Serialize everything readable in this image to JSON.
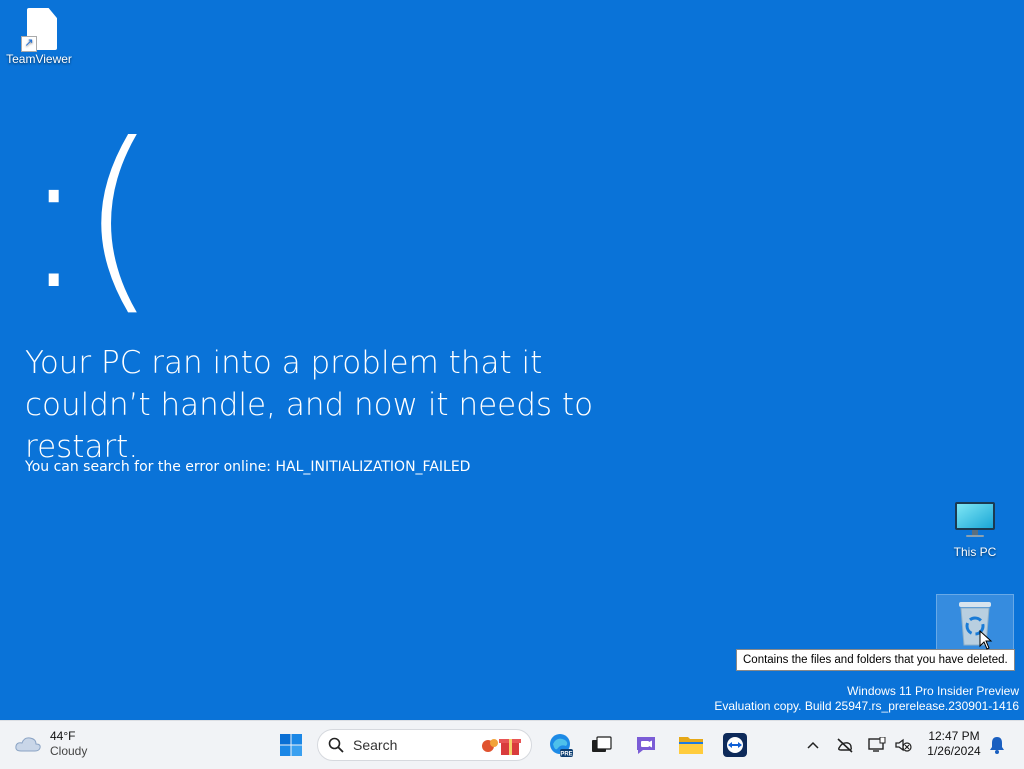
{
  "desktop": {
    "icons": [
      {
        "label": "TeamViewer"
      },
      {
        "label": "This PC"
      },
      {
        "label": "Recycle Bin"
      }
    ],
    "tooltip": "Contains the files and folders that you have deleted."
  },
  "bsod": {
    "face": ":(",
    "headline": "Your PC ran into a problem that it couldn’t handle, and now it needs to restart.",
    "search_hint": "You can search for the error online: HAL_INITIALIZATION_FAILED"
  },
  "watermark": {
    "line1": "Windows 11 Pro Insider Preview",
    "line2": "Evaluation copy. Build 25947.rs_prerelease.230901-1416"
  },
  "taskbar": {
    "weather": {
      "temp": "44°F",
      "condition": "Cloudy"
    },
    "search_placeholder": "Search",
    "clock": {
      "time": "12:47 PM",
      "date": "1/26/2024"
    }
  },
  "colors": {
    "bsod_blue": "#0a73d8",
    "taskbar_bg": "#f1f3f6",
    "accent": "#0067c0"
  }
}
